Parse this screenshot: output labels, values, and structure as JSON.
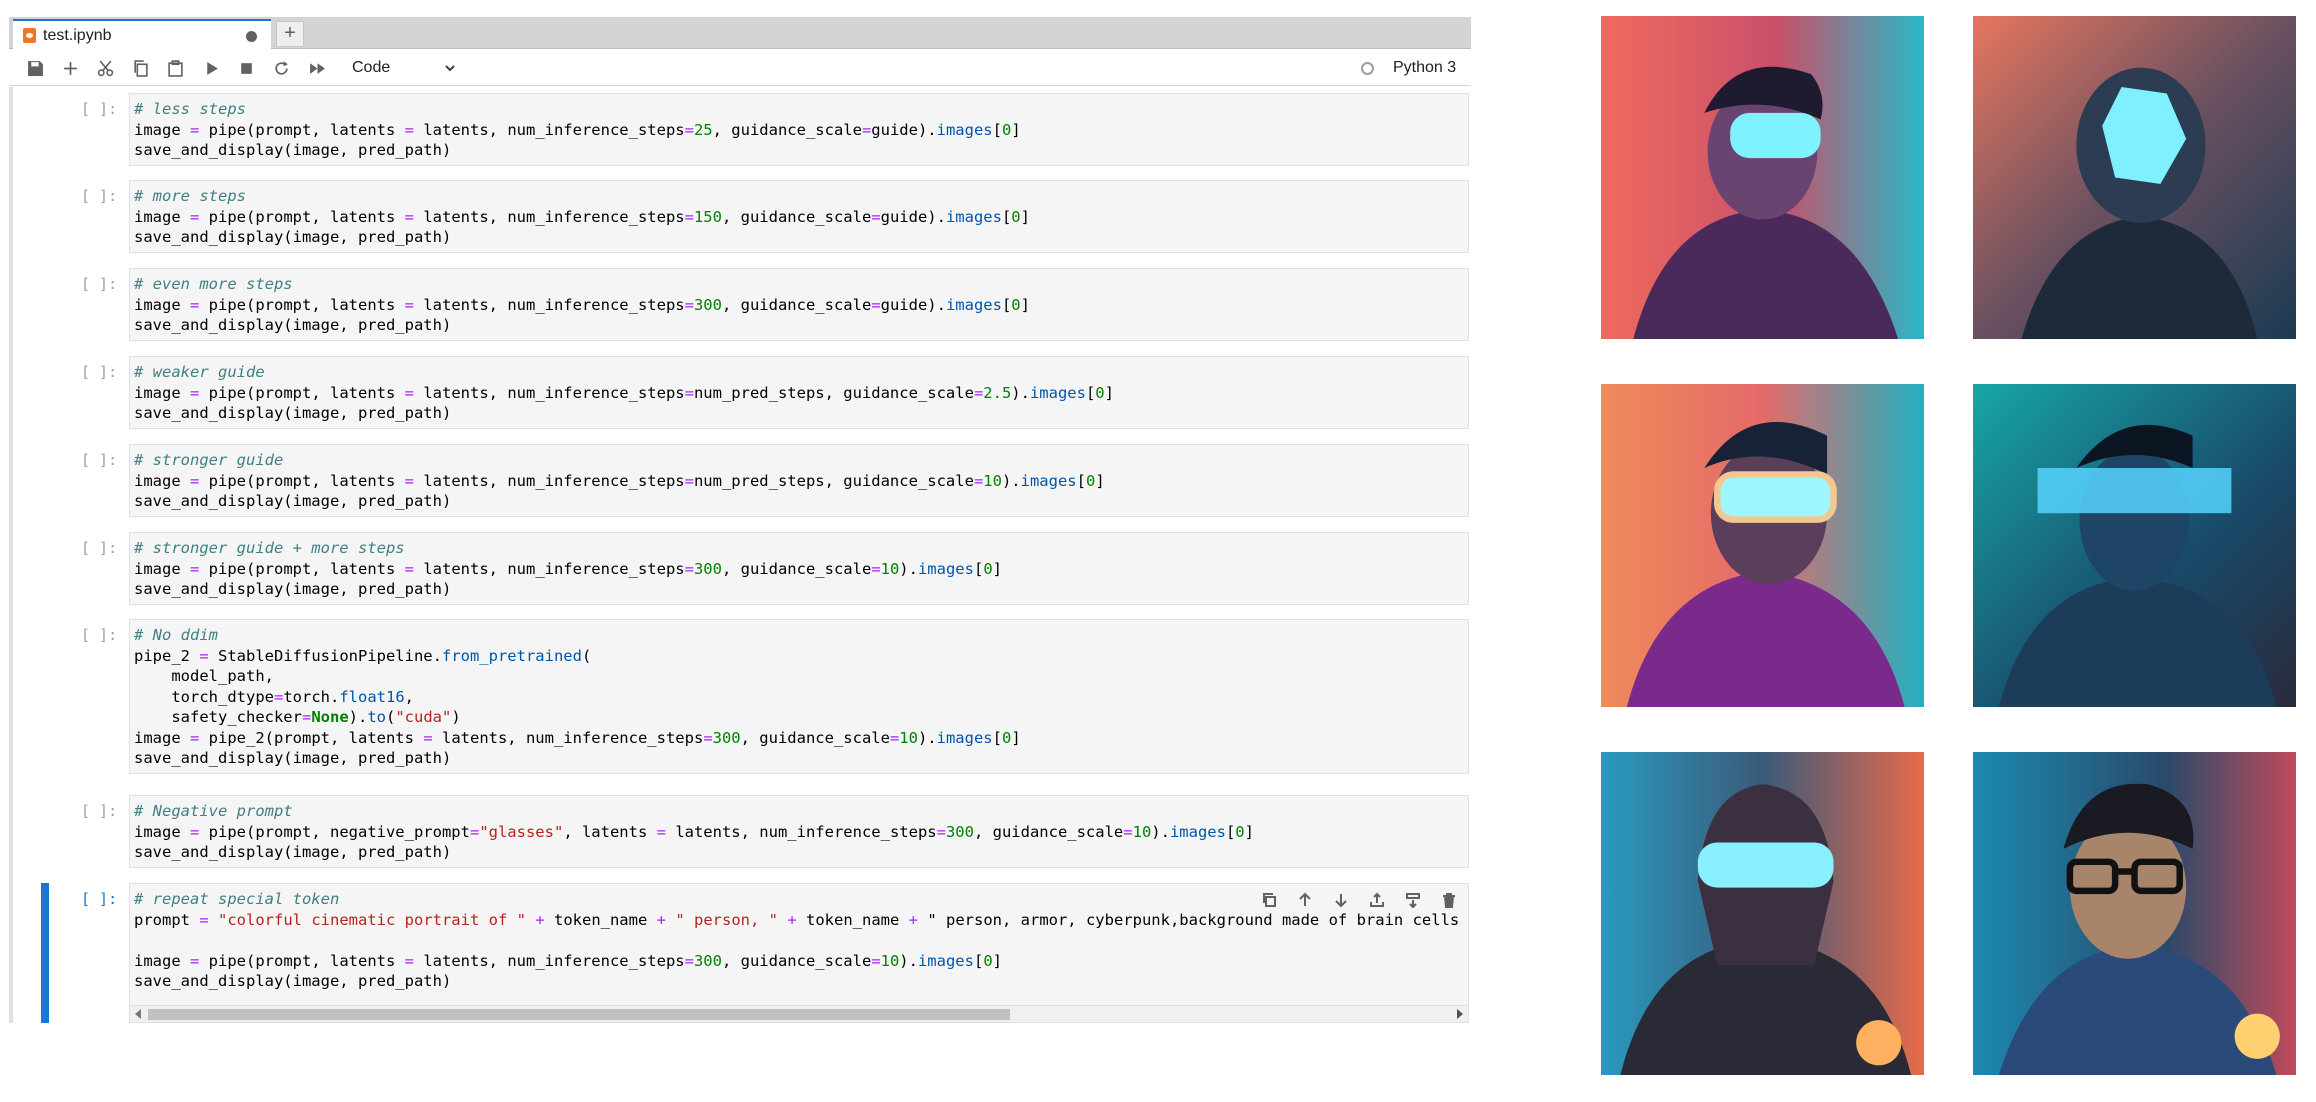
{
  "tab": {
    "title": "test.ipynb",
    "new_tab_label": "+"
  },
  "toolbar": {
    "cell_type": "Code",
    "kernel": "Python 3"
  },
  "cells": [
    {
      "prompt": "[ ]:",
      "lines": [
        "# less steps",
        "image = pipe(prompt, latents = latents, num_inference_steps=25, guidance_scale=guide).images[0]",
        "save_and_display(image, pred_path)"
      ]
    },
    {
      "prompt": "[ ]:",
      "lines": [
        "# more steps",
        "image = pipe(prompt, latents = latents, num_inference_steps=150, guidance_scale=guide).images[0]",
        "save_and_display(image, pred_path)"
      ]
    },
    {
      "prompt": "[ ]:",
      "lines": [
        "# even more steps",
        "image = pipe(prompt, latents = latents, num_inference_steps=300, guidance_scale=guide).images[0]",
        "save_and_display(image, pred_path)"
      ]
    },
    {
      "prompt": "[ ]:",
      "lines": [
        "# weaker guide",
        "image = pipe(prompt, latents = latents, num_inference_steps=num_pred_steps, guidance_scale=2.5).images[0]",
        "save_and_display(image, pred_path)"
      ]
    },
    {
      "prompt": "[ ]:",
      "lines": [
        "# stronger guide",
        "image = pipe(prompt, latents = latents, num_inference_steps=num_pred_steps, guidance_scale=10).images[0]",
        "save_and_display(image, pred_path)"
      ]
    },
    {
      "prompt": "[ ]:",
      "lines": [
        "# stronger guide + more steps",
        "image = pipe(prompt, latents = latents, num_inference_steps=300, guidance_scale=10).images[0]",
        "save_and_display(image, pred_path)"
      ]
    },
    {
      "prompt": "[ ]:",
      "lines": [
        "# No ddim",
        "pipe_2 = StableDiffusionPipeline.from_pretrained(",
        "    model_path,",
        "    torch_dtype=torch.float16,",
        "    safety_checker=None).to(\"cuda\")",
        "image = pipe_2(prompt, latents = latents, num_inference_steps=300, guidance_scale=10).images[0]",
        "save_and_display(image, pred_path)"
      ]
    },
    {
      "prompt": "[ ]:",
      "lines": [
        "# Negative prompt",
        "image = pipe(prompt, negative_prompt=\"glasses\", latents = latents, num_inference_steps=300, guidance_scale=10).images[0]",
        "save_and_display(image, pred_path)"
      ]
    },
    {
      "prompt": "[ ]:",
      "lines": [
        "# repeat special token",
        "prompt = \"colorful cinematic portrait of \" + token_name + \" person, \" + token_name + \" person, armor, cyberpunk,background made of brain cells",
        "",
        "image = pipe(prompt, latents = latents, num_inference_steps=300, guidance_scale=10).images[0]",
        "save_and_display(image, pred_path)"
      ]
    }
  ],
  "icons": {
    "toolbar": [
      "save-icon",
      "add-cell-icon",
      "cut-icon",
      "copy-icon",
      "paste-icon",
      "run-icon",
      "stop-icon",
      "restart-icon",
      "fast-forward-icon"
    ],
    "cell_actions": [
      "duplicate-icon",
      "move-up-icon",
      "move-down-icon",
      "insert-above-icon",
      "insert-below-icon",
      "delete-icon"
    ]
  },
  "colors": {
    "accent": "#1976d2",
    "kernel_icon": "#f37626",
    "comment": "#408080",
    "number": "#008000",
    "operator": "#aa22ff",
    "string": "#ba2121"
  }
}
